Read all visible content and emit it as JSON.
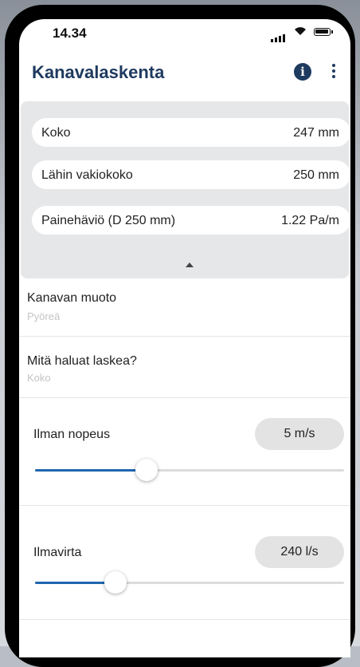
{
  "status_bar": {
    "time": "14.34"
  },
  "app_bar": {
    "title": "Kanavalaskenta",
    "info_icon": "info-icon",
    "more_icon": "more-vert-icon"
  },
  "results": {
    "rows": [
      {
        "label": "Koko",
        "value": "247 mm"
      },
      {
        "label": "Lähin vakiokoko",
        "value": "250 mm"
      },
      {
        "label": "Painehäviö (D 250 mm)",
        "value": "1.22 Pa/m"
      }
    ],
    "collapse_icon": "triangle-up-icon"
  },
  "settings": {
    "duct_shape": {
      "title": "Kanavan muoto",
      "value": "Pyöreä"
    },
    "calculate": {
      "title": "Mitä haluat laskea?",
      "value": "Koko"
    }
  },
  "sliders": {
    "velocity": {
      "label": "Ilman nopeus",
      "value": "5 m/s",
      "level": 0.36
    },
    "airflow": {
      "label": "Ilmavirta",
      "value": "240 l/s",
      "level": 0.26
    }
  },
  "colors": {
    "accent": "#1f66b0",
    "title": "#1e3a5f"
  }
}
